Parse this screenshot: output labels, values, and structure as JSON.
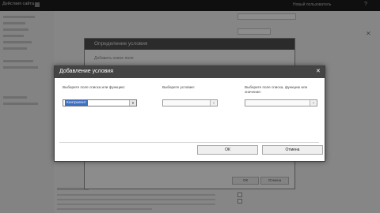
{
  "dialog": {
    "title": "Добавление условия",
    "columns": [
      {
        "label": "Выберите поле списка или функцию:",
        "value": "Контрагент"
      },
      {
        "label": "Выберите условие:",
        "value": ""
      },
      {
        "label": "Выберите поле списка, функцию или значение:",
        "value": ""
      }
    ],
    "ok_label": "ОК",
    "cancel_label": "Отмена"
  },
  "back_dialog": {
    "title": "Определение условия",
    "subtitle": "Добавить новое поле",
    "ok_label": "ОК",
    "cancel_label": "Отмена"
  },
  "topbar": {
    "brand": "Действия сайта",
    "user": "Новый пользователь"
  },
  "colors": {
    "titlebar": "#444444",
    "selection": "#3b6fc4",
    "overlay": "rgba(0,0,0,0.45)"
  }
}
